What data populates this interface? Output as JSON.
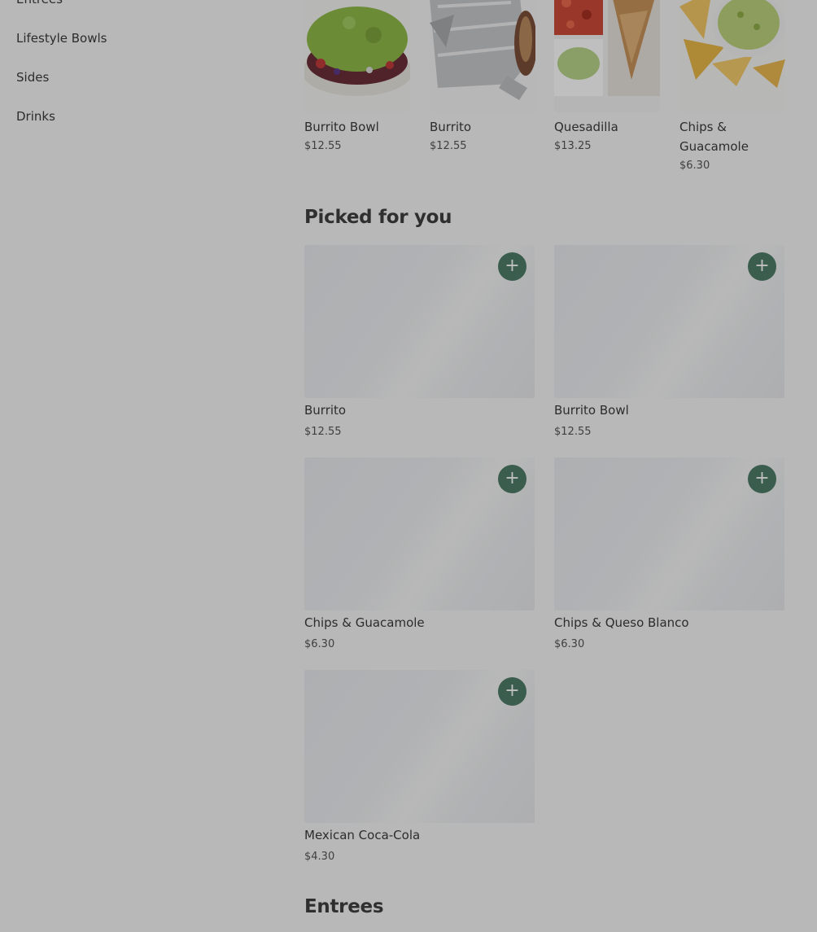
{
  "sidebar": {
    "items": [
      {
        "label": "Entrees"
      },
      {
        "label": "Lifestyle Bowls"
      },
      {
        "label": "Sides"
      },
      {
        "label": "Drinks"
      }
    ]
  },
  "top_items": [
    {
      "name": "Burrito Bowl",
      "price": "$12.55"
    },
    {
      "name": "Burrito",
      "price": "$12.55"
    },
    {
      "name": "Quesadilla",
      "price": "$13.25"
    },
    {
      "name": "Chips & Guacamole",
      "price": "$6.30"
    }
  ],
  "picked": {
    "title": "Picked for you",
    "add_symbol": "+",
    "items": [
      {
        "name": "Burrito",
        "price": "$12.55"
      },
      {
        "name": "Burrito Bowl",
        "price": "$12.55"
      },
      {
        "name": "Chips & Guacamole",
        "price": "$6.30"
      },
      {
        "name": "Chips & Queso Blanco",
        "price": "$6.30"
      },
      {
        "name": "Mexican Coca-Cola",
        "price": "$4.30"
      }
    ]
  },
  "entrees": {
    "title": "Entrees"
  },
  "colors": {
    "accent": "#4e7c68",
    "overlay": "rgba(0,0,0,0.25)"
  }
}
